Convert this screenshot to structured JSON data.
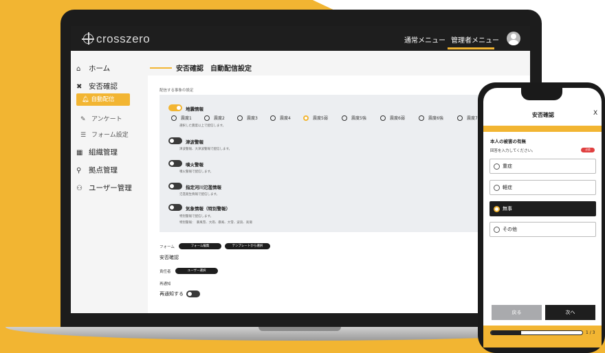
{
  "header": {
    "logo": "crosszero",
    "user_menu": "通常メニュー",
    "admin_menu": "管理者メニュー"
  },
  "sidebar": {
    "home": "ホーム",
    "safety": "安否確認",
    "auto_delivery": "自動配信",
    "survey": "アンケート",
    "form_settings": "フォーム設定",
    "org": "組織管理",
    "base": "拠点管理",
    "users": "ユーザー管理"
  },
  "main": {
    "title": "安否確認　自動配信設定",
    "section_label": "配信する事象の設定",
    "earthquake": {
      "title": "地震情報",
      "desc": "選択した震度以上で配信します。",
      "enabled": true,
      "options": [
        "震度1",
        "震度2",
        "震度3",
        "震度4",
        "震度5弱",
        "震度5強",
        "震度6弱",
        "震度6強",
        "震度7"
      ],
      "selected": "震度5弱"
    },
    "tsunami": {
      "title": "津波警報",
      "desc": "津波警報、大津波警報で配信します。",
      "enabled": false
    },
    "eruption": {
      "title": "噴火警報",
      "desc": "噴火警報で配信します。",
      "enabled": false
    },
    "flood": {
      "title": "指定河川氾濫情報",
      "desc": "氾濫発生情報で配信します。",
      "enabled": false
    },
    "weather": {
      "title": "気象情報（特別警報）",
      "desc1": "特別警報で配信します。",
      "desc2": "特別警報：　暴風雪、大雨、暴風、大雪、波浪、高潮",
      "enabled": false
    },
    "form_label": "フォーム",
    "form_edit_btn": "フォーム編集",
    "template_btn": "テンプレートから選択",
    "form_name": "安否確認",
    "owner_label": "責任者",
    "user_select_btn": "ユーザー選択",
    "renotify_label": "再通知",
    "renotify_toggle_label": "再通知する"
  },
  "phone": {
    "title": "安否確認",
    "close": "X",
    "question": "本人の被害の有無",
    "instruction": "回答を入力してください。",
    "required": "必須",
    "options": [
      "重症",
      "軽症",
      "無事",
      "その他"
    ],
    "selected": "無事",
    "back": "戻る",
    "next": "次へ",
    "page": "1 / 3",
    "progress": 0.333
  },
  "colors": {
    "accent": "#f2b532",
    "dark": "#1e1e1e"
  }
}
